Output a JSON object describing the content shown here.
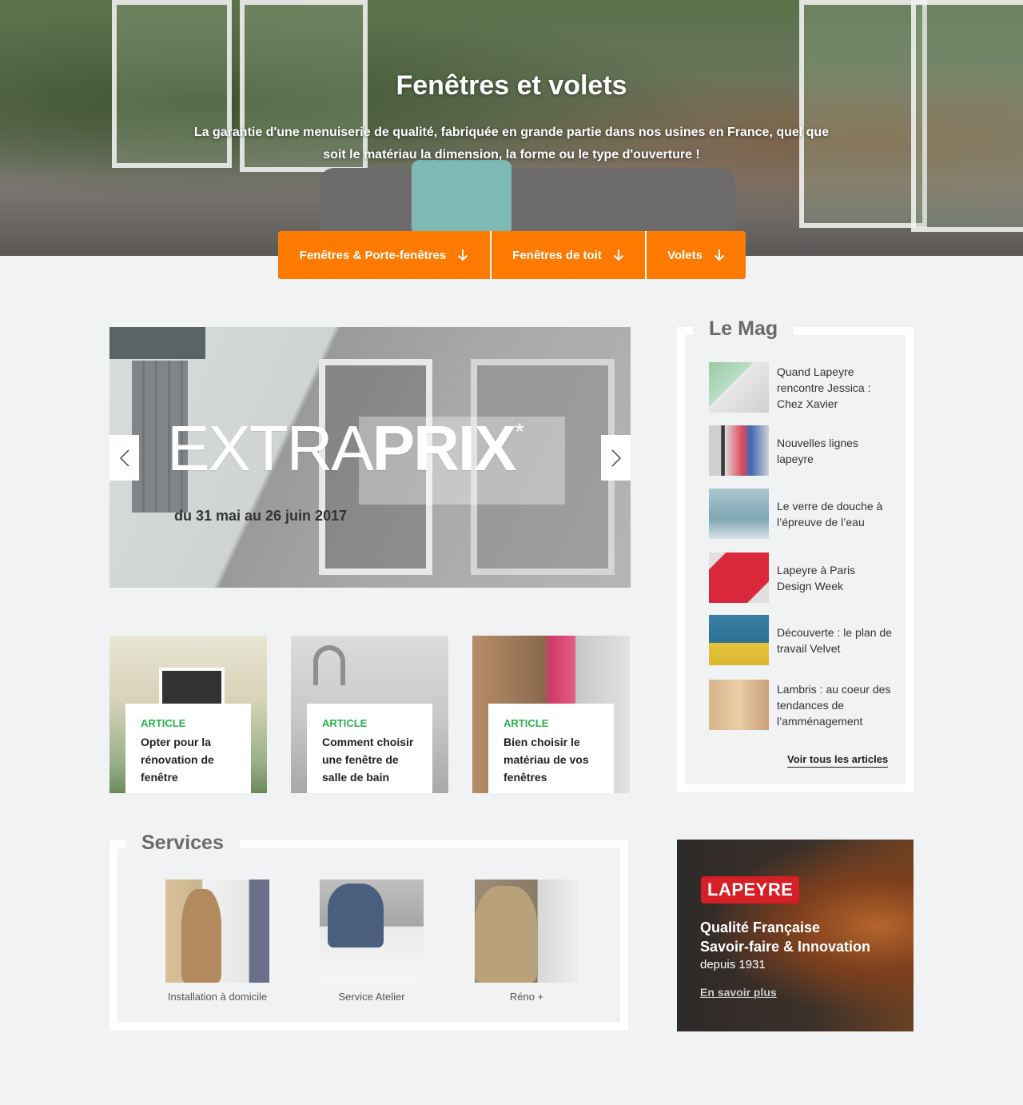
{
  "hero": {
    "title": "Fenêtres et volets",
    "subtitle": "La garantie d'une menuiserie de qualité, fabriquée en grande partie dans nos usines en France, quel que soit le matériau la dimension, la forme ou le type d'ouverture !",
    "buttons": [
      {
        "label": "Fenêtres & Porte-fenêtres",
        "icon": "arrow-down-icon"
      },
      {
        "label": "Fenêtres de toit",
        "icon": "arrow-down-icon"
      },
      {
        "label": "Volets",
        "icon": "arrow-down-icon"
      }
    ]
  },
  "carousel": {
    "title_light": "EXTRA",
    "title_bold": "PRIX",
    "title_mark": "*",
    "dates": "du 31 mai au 26 juin 2017",
    "prev_icon": "chevron-left-icon",
    "next_icon": "chevron-right-icon"
  },
  "articles": [
    {
      "tag": "ARTICLE",
      "title": "Opter pour la rénovation de fenêtre"
    },
    {
      "tag": "ARTICLE",
      "title": "Comment choisir une fenêtre de salle de bain"
    },
    {
      "tag": "ARTICLE",
      "title": "Bien choisir le matériau de vos fenêtres"
    }
  ],
  "mag": {
    "title": "Le Mag",
    "items": [
      {
        "label": "Quand Lapeyre rencontre Jessica : Chez Xavier"
      },
      {
        "label": "Nouvelles lignes lapeyre"
      },
      {
        "label": "Le verre de douche à l’épreuve de l’eau"
      },
      {
        "label": "Lapeyre à Paris Design Week"
      },
      {
        "label": "Découverte : le plan de travail Velvet"
      },
      {
        "label": "Lambris : au coeur des tendances de l’amménagement"
      }
    ],
    "more": "Voir tous les articles"
  },
  "services": {
    "title": "Services",
    "items": [
      {
        "label": "Installation à domicile"
      },
      {
        "label": "Service Atelier"
      },
      {
        "label": "Réno +"
      }
    ]
  },
  "promo": {
    "logo": "LAPEYRE",
    "line1": "Qualité Française",
    "line2": "Savoir-faire & Innovation",
    "line3": "depuis 1931",
    "more": "En savoir plus"
  },
  "colors": {
    "accent": "#ff7a00",
    "article_tag": "#26b24b",
    "brand_red": "#d71f26",
    "page_bg": "#f1f2f3"
  }
}
